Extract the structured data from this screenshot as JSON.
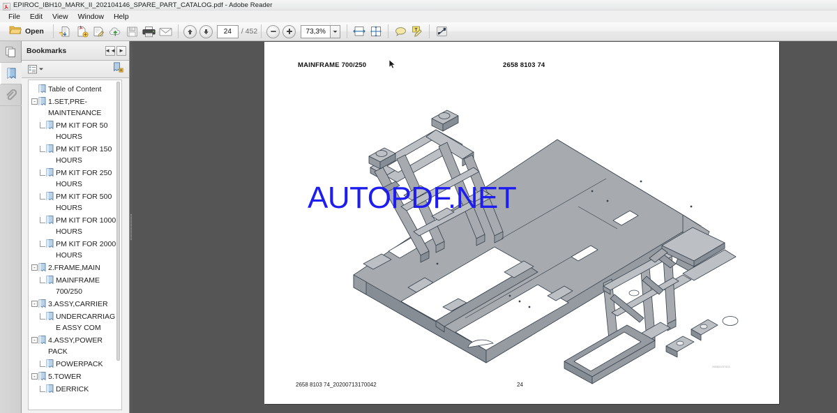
{
  "window": {
    "title": "EPIROC_IBH10_MARK_II_202104146_SPARE_PART_CATALOG.pdf - Adobe Reader",
    "app_icon": "adobe-reader-icon"
  },
  "menubar": {
    "items": [
      {
        "label": "File"
      },
      {
        "label": "Edit"
      },
      {
        "label": "View"
      },
      {
        "label": "Window"
      },
      {
        "label": "Help"
      }
    ]
  },
  "toolbar": {
    "open_label": "Open",
    "open_icon": "folder-open-icon",
    "buttons": [
      {
        "name": "save-copy-icon"
      },
      {
        "name": "create-pdf-icon"
      },
      {
        "name": "sign-icon"
      },
      {
        "name": "upload-cloud-icon"
      },
      {
        "name": "save-icon"
      },
      {
        "name": "print-icon"
      },
      {
        "name": "email-icon"
      }
    ],
    "prev_page_icon": "arrow-up-icon",
    "next_page_icon": "arrow-down-icon",
    "page_number": "24",
    "page_total": "/ 452",
    "zoom_out_icon": "minus-circle-icon",
    "zoom_in_icon": "plus-circle-icon",
    "zoom_value": "73,3%",
    "zoom_dropdown_icon": "chevron-down-icon",
    "fit_width_icon": "fit-width-icon",
    "fit_page_icon": "fit-page-icon",
    "comment_icon": "comment-bubble-icon",
    "highlight_icon": "highlight-text-icon",
    "fullscreen_icon": "expand-fullscreen-icon"
  },
  "rail": {
    "items": [
      {
        "name": "page-thumbnails-icon",
        "selected": false
      },
      {
        "name": "bookmarks-icon",
        "selected": true
      },
      {
        "name": "attachments-icon",
        "selected": false
      }
    ]
  },
  "bookmarks_panel": {
    "title": "Bookmarks",
    "collapse_icon": "◄◄",
    "expand_icon": "►",
    "options_icon": "bookmark-options-icon",
    "options_caret": "▾",
    "new_bookmark_icon": "new-bookmark-icon",
    "items": [
      {
        "label": "Table of Content",
        "level": 0,
        "expander": "",
        "connector": false
      },
      {
        "label": "1.SET,PRE-MAINTENANCE",
        "level": 0,
        "expander": "-",
        "connector": false
      },
      {
        "label": "PM KIT FOR 50 HOURS",
        "level": 1,
        "expander": "",
        "connector": true
      },
      {
        "label": "PM KIT FOR 150 HOURS",
        "level": 1,
        "expander": "",
        "connector": true
      },
      {
        "label": "PM KIT FOR 250 HOURS",
        "level": 1,
        "expander": "",
        "connector": true
      },
      {
        "label": "PM KIT FOR 500 HOURS",
        "level": 1,
        "expander": "",
        "connector": true
      },
      {
        "label": "PM KIT FOR 1000 HOURS",
        "level": 1,
        "expander": "",
        "connector": true
      },
      {
        "label": "PM KIT FOR 2000 HOURS",
        "level": 1,
        "expander": "",
        "connector": true
      },
      {
        "label": "2.FRAME,MAIN",
        "level": 0,
        "expander": "-",
        "connector": false
      },
      {
        "label": "MAINFRAME 700/250",
        "level": 1,
        "expander": "",
        "connector": true
      },
      {
        "label": "3.ASSY,CARRIER",
        "level": 0,
        "expander": "-",
        "connector": false
      },
      {
        "label": "UNDERCARRIAGE ASSY COM",
        "level": 1,
        "expander": "",
        "connector": true
      },
      {
        "label": "4.ASSY,POWER PACK",
        "level": 0,
        "expander": "-",
        "connector": false
      },
      {
        "label": "POWERPACK",
        "level": 1,
        "expander": "",
        "connector": true
      },
      {
        "label": "5.TOWER",
        "level": 0,
        "expander": "-",
        "connector": false
      },
      {
        "label": "DERRICK",
        "level": 1,
        "expander": "",
        "connector": true
      }
    ]
  },
  "document_page": {
    "header_left": "MAINFRAME 700/250",
    "header_right": "2658 8103 74",
    "footer_left": "2658 8103 74_20200713170042",
    "footer_center": "24",
    "fine_print": "265881037401",
    "watermark": "AUTOPDF.NET",
    "watermark_color": "#1d1df0",
    "drawing_name": "mainframe-isometric-drawing"
  }
}
